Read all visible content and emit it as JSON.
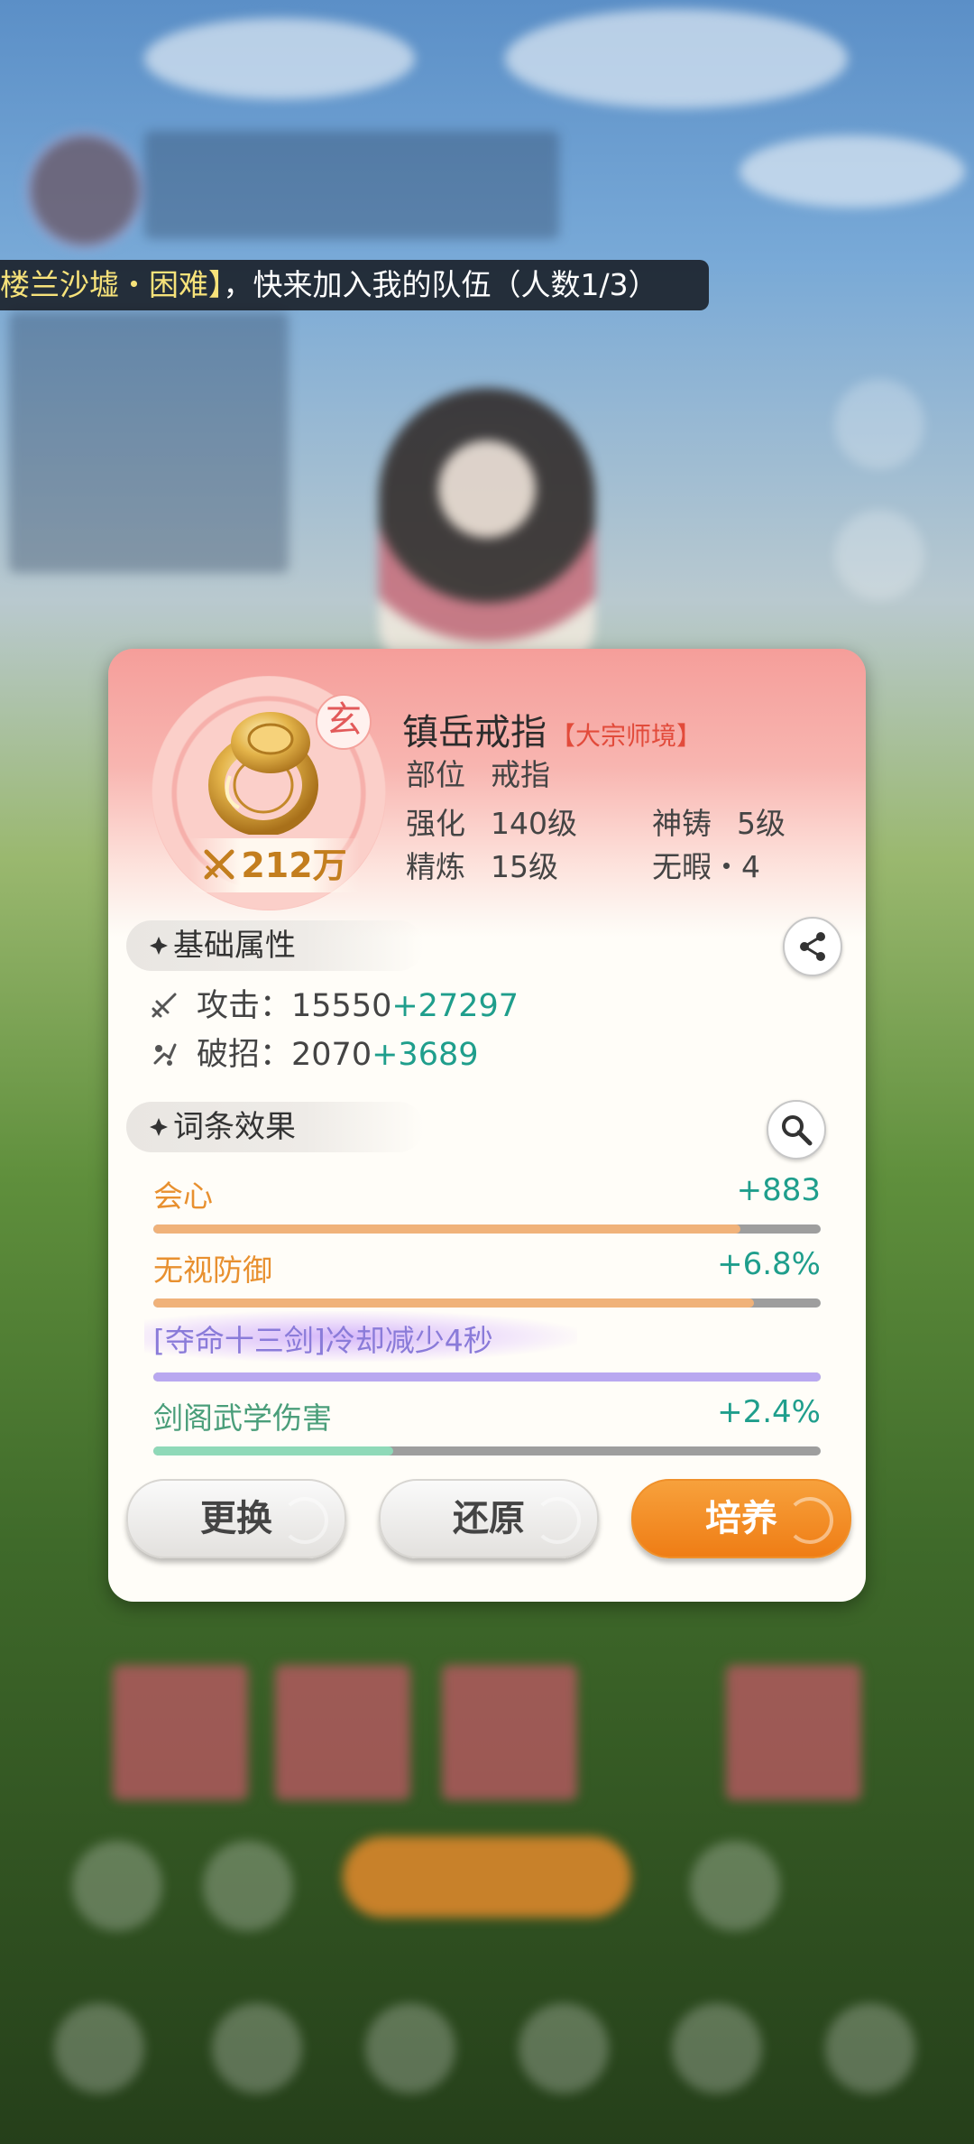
{
  "ticker": {
    "highlight": "楼兰沙墟・困难】",
    "message": "，快来加入我的队伍（人数1/3）"
  },
  "item": {
    "grade_badge": "玄",
    "power": "212万",
    "name": "镇岳戒指",
    "realm": "【大宗师境】",
    "slot_label": "部位",
    "slot_value": "戒指",
    "enhance_label": "强化",
    "enhance_value": "140级",
    "forge_label": "神铸",
    "forge_value": "5级",
    "refine_label": "精炼",
    "refine_value": "15级",
    "flawless_label": "无暇・4"
  },
  "base_section": {
    "title": "基础属性",
    "share_icon": "share-icon",
    "attrs": [
      {
        "icon": "attack-icon",
        "label": "攻击：",
        "base": "15550",
        "bonus": "+27297"
      },
      {
        "icon": "break-icon",
        "label": "破招：",
        "base": "2070",
        "bonus": "+3689"
      }
    ]
  },
  "entries_section": {
    "title": "词条效果",
    "search_icon": "search-icon",
    "entries": [
      {
        "name": "会心",
        "value": "+883",
        "fill": 0.88,
        "name_color": "#e8902f",
        "bar_color": "#f0b27a"
      },
      {
        "name": "无视防御",
        "value": "+6.8%",
        "fill": 0.9,
        "name_color": "#e8902f",
        "bar_color": "#f0b27a"
      },
      {
        "name": "[夺命十三剑]冷却减少4秒",
        "value": "",
        "fill": 1.0,
        "name_color": "#8a7bd9",
        "bar_color": "#b9a8f0"
      },
      {
        "name": "剑阁武学伤害",
        "value": "+2.4%",
        "fill": 0.36,
        "name_color": "#4a9e7a",
        "bar_color": "#8fd9b8"
      }
    ]
  },
  "buttons": {
    "replace": "更换",
    "restore": "还原",
    "cultivate": "培养"
  },
  "colors": {
    "accent_orange": "#ef7d15",
    "bonus_teal": "#1f9e8c",
    "realm_red": "#e24b3b",
    "power_gold": "#c37e1e"
  }
}
